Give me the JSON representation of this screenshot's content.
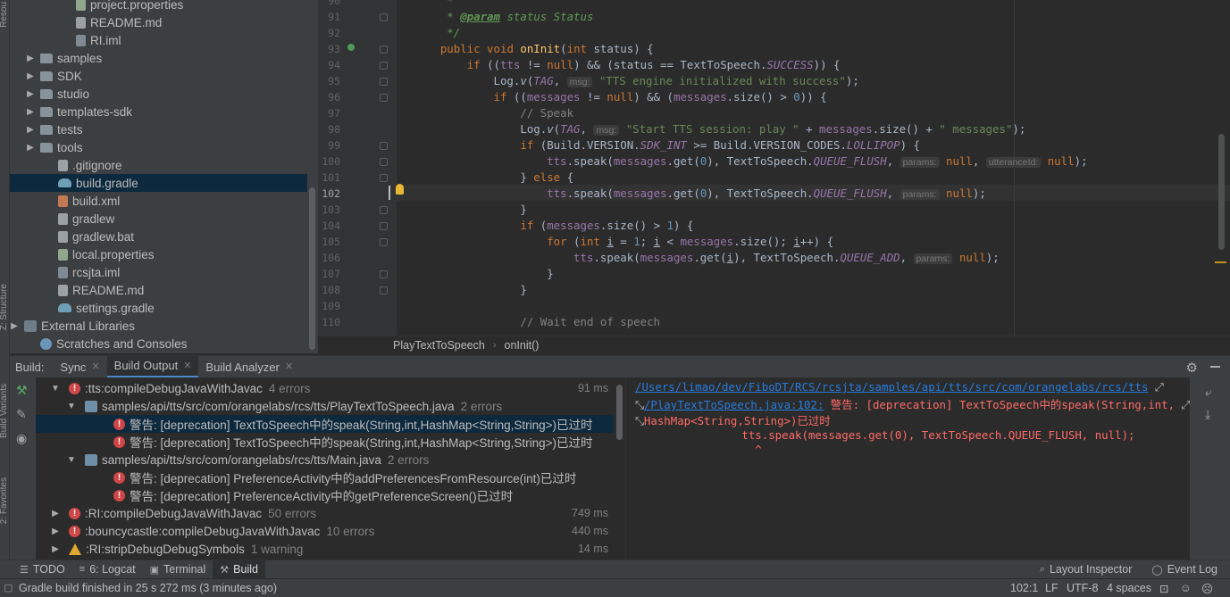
{
  "side_labels": {
    "resource": "Resou",
    "structure": "Z: Structure",
    "variants": "Build Variants",
    "favorites": "2: Favorites"
  },
  "project_tree": [
    {
      "label": "project.properties",
      "icon": "props",
      "indent": 58,
      "arrow": ""
    },
    {
      "label": "README.md",
      "icon": "file",
      "indent": 58,
      "arrow": ""
    },
    {
      "label": "RI.iml",
      "icon": "iml",
      "indent": 58,
      "arrow": ""
    },
    {
      "label": "samples",
      "icon": "folder",
      "indent": 18,
      "arrow": "▶"
    },
    {
      "label": "SDK",
      "icon": "folder",
      "indent": 18,
      "arrow": "▶"
    },
    {
      "label": "studio",
      "icon": "folder",
      "indent": 18,
      "arrow": "▶"
    },
    {
      "label": "templates-sdk",
      "icon": "folder",
      "indent": 18,
      "arrow": "▶"
    },
    {
      "label": "tests",
      "icon": "folder",
      "indent": 18,
      "arrow": "▶"
    },
    {
      "label": "tools",
      "icon": "folder",
      "indent": 18,
      "arrow": "▶"
    },
    {
      "label": ".gitignore",
      "icon": "file",
      "indent": 38,
      "arrow": ""
    },
    {
      "label": "build.gradle",
      "icon": "gradle",
      "indent": 38,
      "arrow": "",
      "selected": true
    },
    {
      "label": "build.xml",
      "icon": "xml",
      "indent": 38,
      "arrow": ""
    },
    {
      "label": "gradlew",
      "icon": "file",
      "indent": 38,
      "arrow": ""
    },
    {
      "label": "gradlew.bat",
      "icon": "file",
      "indent": 38,
      "arrow": ""
    },
    {
      "label": "local.properties",
      "icon": "props",
      "indent": 38,
      "arrow": ""
    },
    {
      "label": "rcsjta.iml",
      "icon": "iml",
      "indent": 38,
      "arrow": ""
    },
    {
      "label": "README.md",
      "icon": "file",
      "indent": 38,
      "arrow": ""
    },
    {
      "label": "settings.gradle",
      "icon": "gradle",
      "indent": 38,
      "arrow": ""
    },
    {
      "label": "External Libraries",
      "icon": "lib",
      "indent": 0,
      "arrow": "▶"
    },
    {
      "label": "Scratches and Consoles",
      "icon": "scratch",
      "indent": 18,
      "arrow": ""
    }
  ],
  "editor": {
    "line_numbers": [
      "90",
      "91",
      "92",
      "93",
      "94",
      "95",
      "96",
      "97",
      "98",
      "99",
      "100",
      "101",
      "102",
      "103",
      "104",
      "105",
      "106",
      "107",
      "108",
      "109",
      "110"
    ],
    "current_line": "102"
  },
  "breadcrumb": {
    "class": "PlayTextToSpeech",
    "method": "onInit()"
  },
  "build": {
    "label": "Build:",
    "tabs": [
      "Sync",
      "Build Output",
      "Build Analyzer"
    ],
    "rows": [
      {
        "icon": "error",
        "indent": 46,
        "arrow": "▼",
        "text": ":tts:compileDebugJavaWithJavac",
        "sub": "4 errors",
        "time": "91 ms"
      },
      {
        "icon": "java",
        "indent": 64,
        "arrow": "▼",
        "text": "samples/api/tts/src/com/orangelabs/rcs/tts/PlayTextToSpeech.java",
        "sub": "2 errors",
        "time": ""
      },
      {
        "icon": "error",
        "indent": 96,
        "arrow": "",
        "text": "警告: [deprecation] TextToSpeech中的speak(String,int,HashMap<String,String>)已过时",
        "sub": "",
        "time": "",
        "selected": true
      },
      {
        "icon": "error",
        "indent": 96,
        "arrow": "",
        "text": "警告: [deprecation] TextToSpeech中的speak(String,int,HashMap<String,String>)已过时",
        "sub": "",
        "time": ""
      },
      {
        "icon": "java",
        "indent": 64,
        "arrow": "▼",
        "text": "samples/api/tts/src/com/orangelabs/rcs/tts/Main.java",
        "sub": "2 errors",
        "time": ""
      },
      {
        "icon": "error",
        "indent": 96,
        "arrow": "",
        "text": "警告: [deprecation] PreferenceActivity中的addPreferencesFromResource(int)已过时",
        "sub": "",
        "time": ""
      },
      {
        "icon": "error",
        "indent": 96,
        "arrow": "",
        "text": "警告: [deprecation] PreferenceActivity中的getPreferenceScreen()已过时",
        "sub": "",
        "time": ""
      },
      {
        "icon": "error",
        "indent": 46,
        "arrow": "▶",
        "text": ":RI:compileDebugJavaWithJavac",
        "sub": "50 errors",
        "time": "749 ms"
      },
      {
        "icon": "error",
        "indent": 46,
        "arrow": "▶",
        "text": ":bouncycastle:compileDebugJavaWithJavac",
        "sub": "10 errors",
        "time": "440 ms"
      },
      {
        "icon": "warning",
        "indent": 46,
        "arrow": "▶",
        "text": ":RI:stripDebugDebugSymbols",
        "sub": "1 warning",
        "time": "14 ms"
      }
    ],
    "console": {
      "path_link": "/Users/limao/dev/FiboDT/RCS/rcsjta/samples/api/tts/src/com/orangelabs/rcs/tts",
      "file_link": "/PlayTextToSpeech.java:102:",
      "message1": " 警告: [deprecation] TextToSpeech中的speak(String,int,",
      "message2": "HashMap<String,String>)已过时",
      "code_line": "                tts.speak(messages.get(0), TextToSpeech.QUEUE_FLUSH, null);",
      "caret": "                  ^"
    }
  },
  "tool_tabs": [
    {
      "icon": "list-icon",
      "glyph": "☰",
      "label": "TODO"
    },
    {
      "icon": "logcat-icon",
      "glyph": "≡",
      "label": "6: Logcat"
    },
    {
      "icon": "terminal-icon",
      "glyph": "▣",
      "label": "Terminal"
    },
    {
      "icon": "hammer-icon",
      "glyph": "⚒",
      "label": "Build",
      "active": true
    }
  ],
  "right_tool_tabs": [
    {
      "icon": "layout-inspector-icon",
      "glyph": "⌕",
      "label": "Layout Inspector"
    },
    {
      "icon": "event-log-icon",
      "glyph": "◯",
      "label": "Event Log"
    }
  ],
  "status": {
    "message": "Gradle build finished in 25 s 272 ms (3 minutes ago)",
    "position": "102:1",
    "line_sep": "LF",
    "encoding": "UTF-8",
    "indent": "4 spaces"
  },
  "colors": {
    "accent": "#4a88c7",
    "error": "#d14748",
    "selection": "#0d293e"
  }
}
